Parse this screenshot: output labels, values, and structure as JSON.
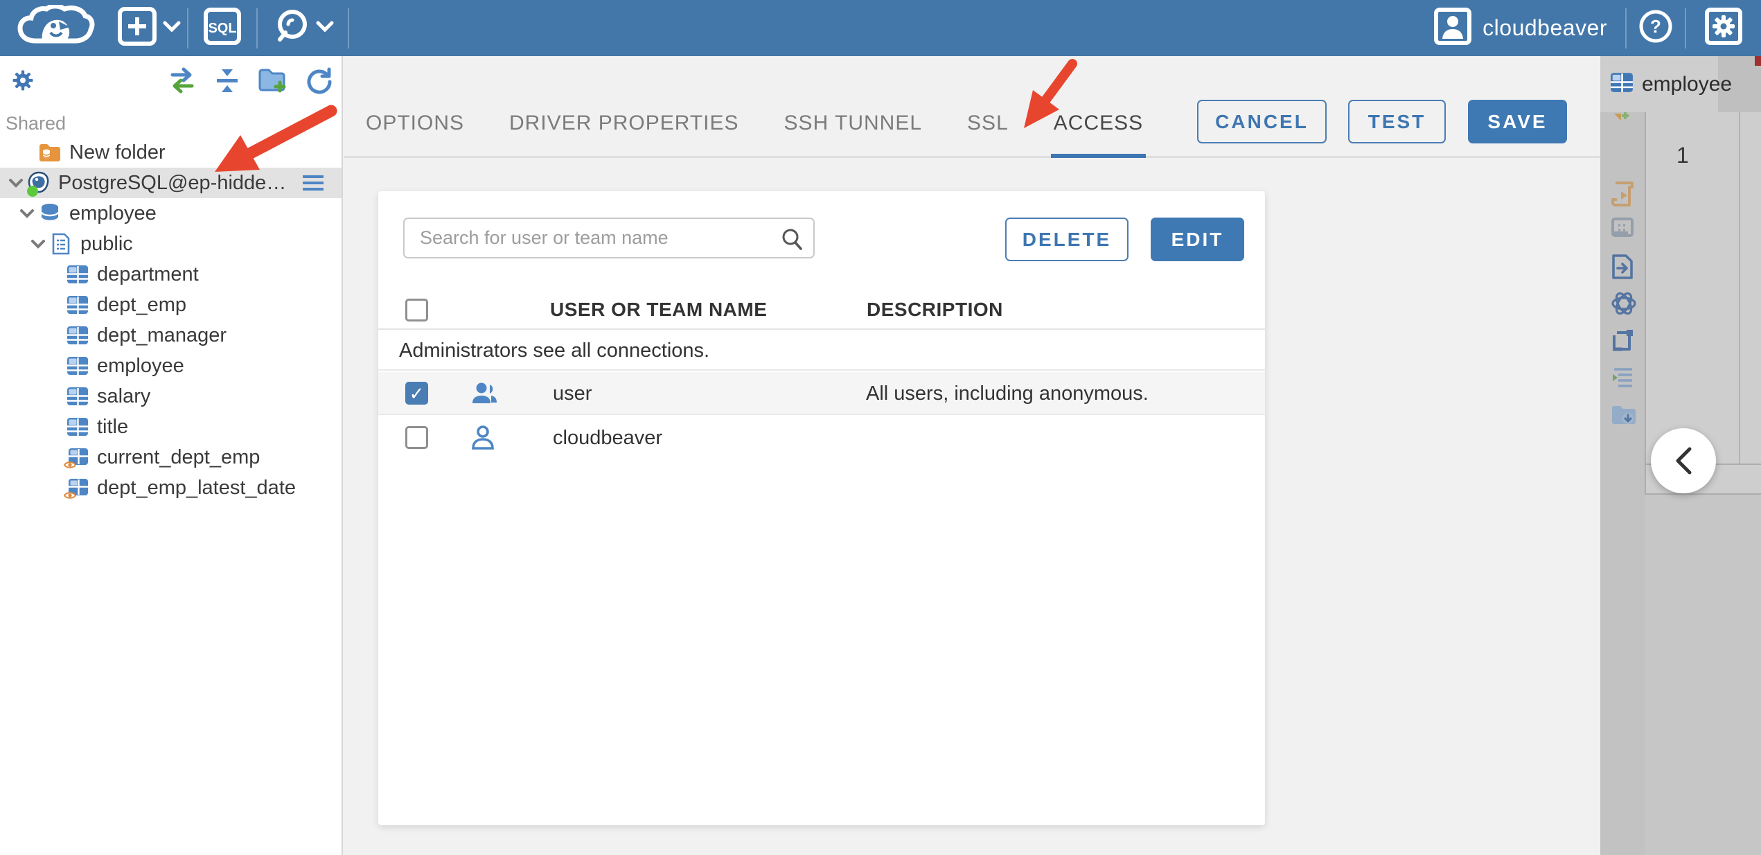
{
  "topbar": {
    "user_label": "cloudbeaver",
    "icons": [
      "cloudbeaver-logo",
      "new-connection-plus",
      "sql-editor",
      "connection-search",
      "user-avatar",
      "help",
      "settings-gear"
    ],
    "color": "#4377a9"
  },
  "sidebar": {
    "section_label": "Shared",
    "toolbar_icons": [
      "settings-gear",
      "sync-arrows",
      "collapse-all",
      "new-folder",
      "refresh"
    ],
    "tree": [
      {
        "label": "New folder",
        "type": "folder"
      },
      {
        "label": "PostgreSQL@ep-hidden-...",
        "type": "connection",
        "status": "connected",
        "selected": true
      },
      {
        "label": "employee",
        "type": "database"
      },
      {
        "label": "public",
        "type": "schema"
      },
      {
        "label": "department",
        "type": "table"
      },
      {
        "label": "dept_emp",
        "type": "table"
      },
      {
        "label": "dept_manager",
        "type": "table"
      },
      {
        "label": "employee",
        "type": "table"
      },
      {
        "label": "salary",
        "type": "table"
      },
      {
        "label": "title",
        "type": "table"
      },
      {
        "label": "current_dept_emp",
        "type": "view"
      },
      {
        "label": "dept_emp_latest_date",
        "type": "view"
      }
    ]
  },
  "editor": {
    "tabs": [
      {
        "label": "OPTIONS",
        "active": false
      },
      {
        "label": "DRIVER PROPERTIES",
        "active": false
      },
      {
        "label": "SSH TUNNEL",
        "active": false
      },
      {
        "label": "SSL",
        "active": false
      },
      {
        "label": "ACCESS",
        "active": true
      }
    ],
    "actions": {
      "cancel": "CANCEL",
      "test": "TEST",
      "save": "SAVE"
    },
    "access": {
      "search_placeholder": "Search for user or team name",
      "delete_label": "DELETE",
      "edit_label": "EDIT",
      "columns": {
        "name": "USER OR TEAM NAME",
        "description": "DESCRIPTION"
      },
      "info_text": "Administrators see all connections.",
      "rows": [
        {
          "name": "user",
          "description": "All users, including anonymous.",
          "checked": true,
          "kind": "team"
        },
        {
          "name": "cloudbeaver",
          "description": "",
          "checked": false,
          "kind": "user"
        }
      ]
    }
  },
  "right_panel": {
    "tab_label": "employee",
    "row_number": "1",
    "toolbar_icons": [
      "add-partial",
      "execute-script",
      "grid-view",
      "export-data",
      "ai-assistant",
      "value-panel",
      "grouping",
      "save-to-folder"
    ],
    "collapse_chevron": "left"
  },
  "colors": {
    "topbar_blue": "#4377a9",
    "accent_blue": "#3f79b3",
    "checkbox_checked": "#4a7db3",
    "tab_underline": "#3d76b2",
    "selected_row_gray": "#e2e2e2",
    "annotation_red": "#e8452f",
    "panel_gray": "#c6c6c6",
    "status_green": "#5cc93d"
  }
}
